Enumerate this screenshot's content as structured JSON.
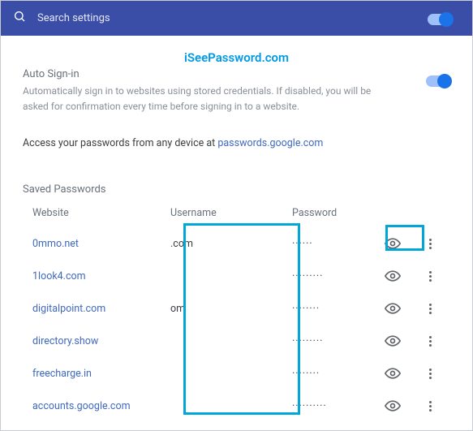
{
  "search": {
    "placeholder": "Search settings"
  },
  "watermark": "iSeePassword.com",
  "autoSignIn": {
    "title": "Auto Sign-in",
    "desc": "Automatically sign in to websites using stored credentials. If disabled, you will be asked for confirmation every time before signing in to a website."
  },
  "accessLine": {
    "prefix": "Access your passwords from any device at ",
    "link": "passwords.google.com"
  },
  "savedTitle": "Saved Passwords",
  "columns": {
    "website": "Website",
    "username": "Username",
    "password": "Password"
  },
  "rows": [
    {
      "website": "0mmo.net",
      "username": ".com",
      "password": "······"
    },
    {
      "website": "1look4.com",
      "username": "",
      "password": "·········"
    },
    {
      "website": "digitalpoint.com",
      "username": "om",
      "password": "········"
    },
    {
      "website": "directory.show",
      "username": "",
      "password": "·········"
    },
    {
      "website": "freecharge.in",
      "username": "",
      "password": "········"
    },
    {
      "website": "accounts.google.com",
      "username": "",
      "password": "··········"
    }
  ]
}
